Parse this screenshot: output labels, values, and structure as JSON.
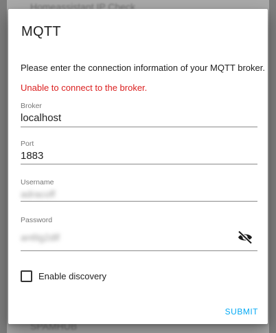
{
  "background": {
    "top_text": "Homeassistant IP Check",
    "bottom_text": "SPAMHUB"
  },
  "dialog": {
    "title": "MQTT",
    "description": "Please enter the connection information of your MQTT broker.",
    "error": "Unable to connect to the broker.",
    "fields": {
      "broker": {
        "label": "Broker",
        "value": "localhost"
      },
      "port": {
        "label": "Port",
        "value": "1883"
      },
      "username": {
        "label": "Username",
        "value": "adracoff"
      },
      "password": {
        "label": "Password",
        "value": "an6lg2dlf"
      }
    },
    "discovery": {
      "label": "Enable discovery",
      "checked": false
    },
    "submit_label": "SUBMIT"
  },
  "colors": {
    "error": "#db1f1f",
    "accent": "#03a9f4"
  },
  "icons": {
    "password_toggle": "eye-off-icon"
  }
}
